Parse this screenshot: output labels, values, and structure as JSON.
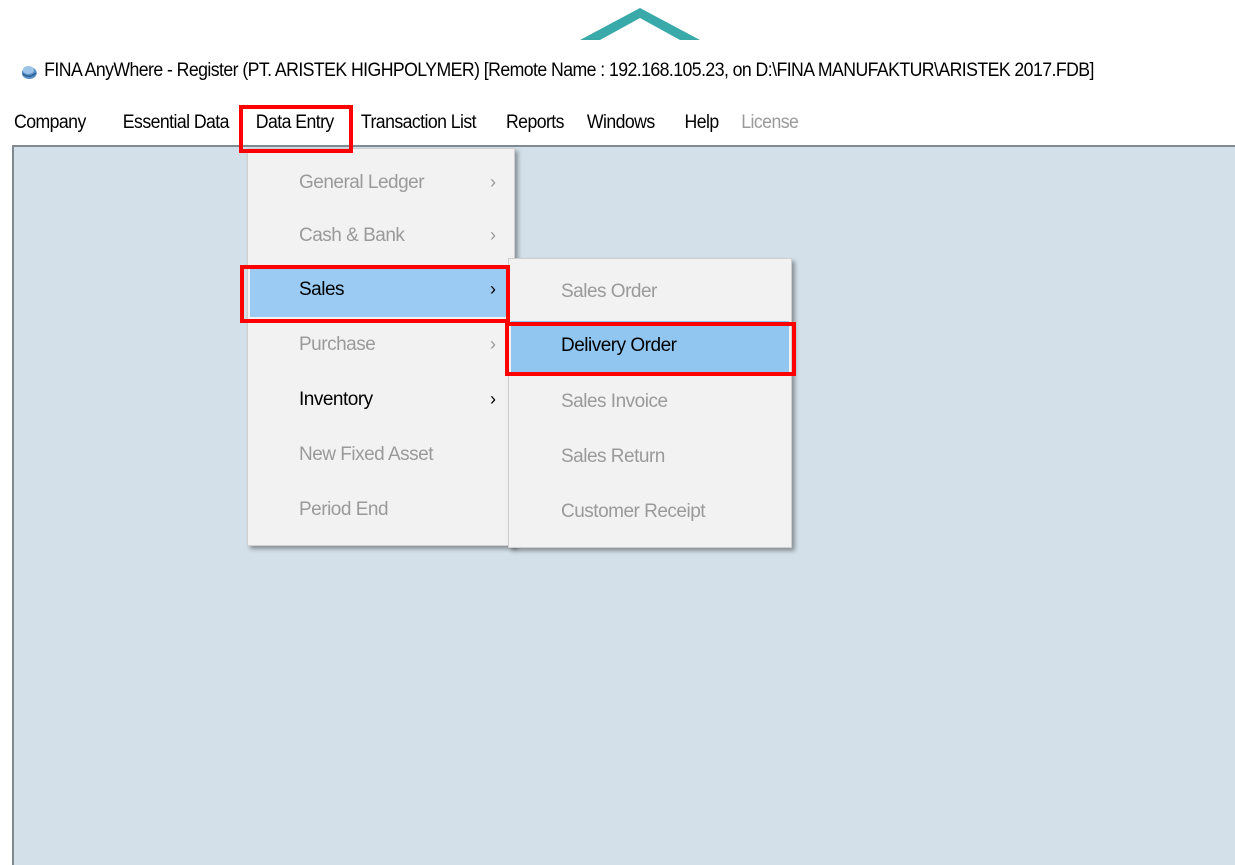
{
  "window": {
    "title": "FINA AnyWhere - Register (PT. ARISTEK HIGHPOLYMER)  [Remote Name : 192.168.105.23, on D:\\FINA MANUFAKTUR\\ARISTEK 2017.FDB]",
    "icon": "app-logo-icon"
  },
  "menubar": {
    "items": [
      {
        "label": "Company",
        "enabled": true
      },
      {
        "label": "Essential Data",
        "enabled": true
      },
      {
        "label": "Data Entry",
        "enabled": true,
        "active": true
      },
      {
        "label": "Transaction List",
        "enabled": true
      },
      {
        "label": "Reports",
        "enabled": true
      },
      {
        "label": "Windows",
        "enabled": true
      },
      {
        "label": "Help",
        "enabled": true
      },
      {
        "label": "License",
        "enabled": false
      }
    ]
  },
  "data_entry_menu": {
    "items": [
      {
        "label": "General Ledger",
        "enabled": false,
        "submenu_arrow": "›"
      },
      {
        "label": "Cash & Bank",
        "enabled": false,
        "submenu_arrow": "›"
      },
      {
        "label": "Sales",
        "enabled": true,
        "selected": true,
        "submenu_arrow": "›"
      },
      {
        "label": "Purchase",
        "enabled": false,
        "submenu_arrow": "›"
      },
      {
        "label": "Inventory",
        "enabled": true,
        "submenu_arrow": "›"
      },
      {
        "label": "New Fixed Asset",
        "enabled": false
      },
      {
        "label": "Period End",
        "enabled": false
      }
    ]
  },
  "sales_submenu": {
    "items": [
      {
        "label": "Sales Order",
        "enabled": false
      },
      {
        "label": "Delivery Order",
        "enabled": true,
        "selected": true
      },
      {
        "label": "Sales Invoice",
        "enabled": false
      },
      {
        "label": "Sales Return",
        "enabled": false
      },
      {
        "label": "Customer Receipt",
        "enabled": false
      }
    ]
  },
  "colors": {
    "workspace": "#d3e0e9",
    "highlight_box": "#ff0000",
    "menu_selection": "#9bcbf2",
    "disabled_text": "#9a9a9a"
  }
}
